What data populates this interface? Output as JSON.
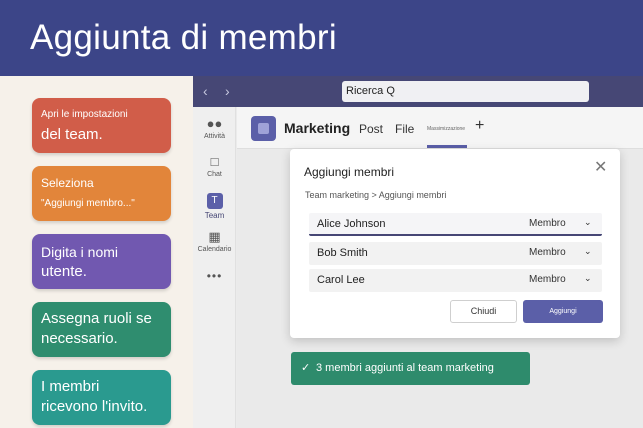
{
  "banner": {
    "title": "Aggiunta di membri"
  },
  "steps": [
    {
      "line1": "Apri le impostazioni",
      "line2": "del team."
    },
    {
      "line1": "Seleziona",
      "line2": "\"Aggiungi membro...\""
    },
    {
      "line1": "Digita i nomi",
      "line2": "utente."
    },
    {
      "line1": "Assegna ruoli se",
      "line2": "necessario."
    },
    {
      "line1": "I membri",
      "line2": "ricevono l'invito."
    }
  ],
  "topbar": {
    "back_icon": "chevron-left-icon",
    "forward_icon": "chevron-right-icon",
    "search_value": "Ricerca Q"
  },
  "rail": {
    "items": [
      {
        "label": "Attività",
        "icon": "people-icon"
      },
      {
        "label": "Chat",
        "icon": "chat-icon"
      },
      {
        "label": "Team",
        "icon": "teams-icon"
      },
      {
        "label": "Calendario",
        "icon": "calendar-icon"
      },
      {
        "label": "•••",
        "icon": "more-icon"
      }
    ]
  },
  "header": {
    "team_name": "Marketing",
    "tabs": [
      "Post",
      "File",
      "Massimizzazione"
    ],
    "plus": "+"
  },
  "dialog": {
    "title": "Aggiungi membri",
    "breadcrumb": "Team marketing > Aggiungi membri",
    "members": [
      {
        "name": "Alice Johnson",
        "role": "Membro"
      },
      {
        "name": "Bob Smith",
        "role": "Membro"
      },
      {
        "name": "Carol Lee",
        "role": "Membro"
      }
    ],
    "close_label": "Chiudi",
    "add_label": "Aggiungi"
  },
  "toast": {
    "message": "3 membri aggiunti al team marketing"
  },
  "colors": {
    "banner": "#3c4588",
    "accent": "#5b5fa8",
    "success": "#2e8b6c"
  }
}
